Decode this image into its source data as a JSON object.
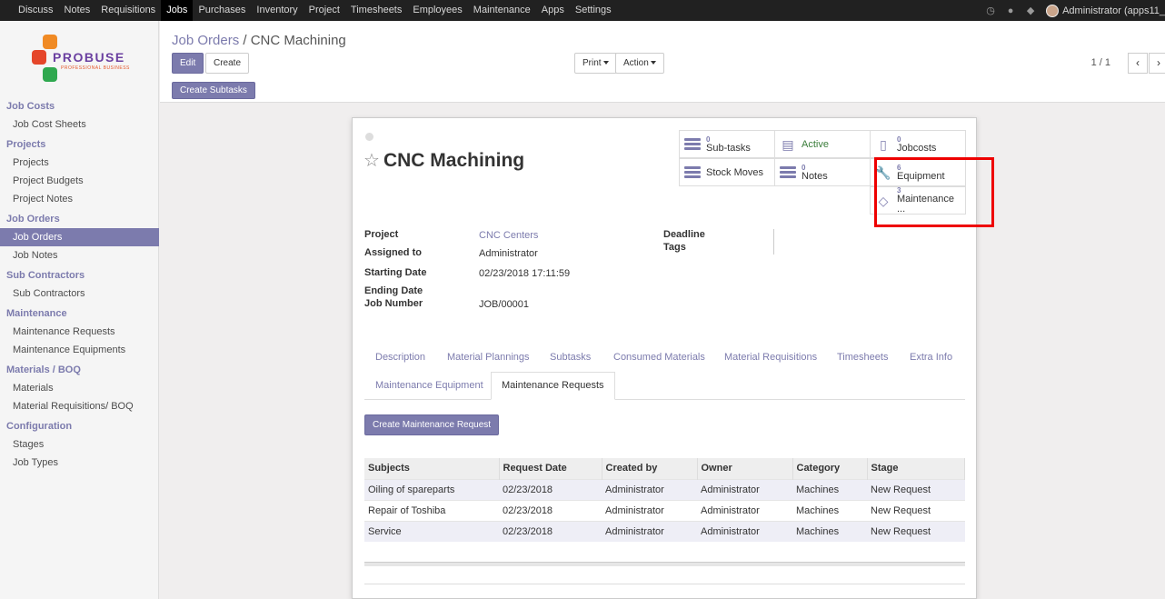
{
  "topnav": {
    "items": [
      "Discuss",
      "Notes",
      "Requisitions",
      "Jobs",
      "Purchases",
      "Inventory",
      "Project",
      "Timesheets",
      "Employees",
      "Maintenance",
      "Apps",
      "Settings"
    ],
    "active": "Jobs",
    "user": "Administrator (apps11_"
  },
  "logo": {
    "word": "PROBUSE",
    "tagline": "PROFESSIONAL BUSINESS"
  },
  "sidebar": {
    "sections": [
      {
        "title": "Job Costs",
        "items": [
          "Job Cost Sheets"
        ]
      },
      {
        "title": "Projects",
        "items": [
          "Projects",
          "Project Budgets",
          "Project Notes"
        ]
      },
      {
        "title": "Job Orders",
        "items": [
          "Job Orders",
          "Job Notes"
        ]
      },
      {
        "title": "Sub Contractors",
        "items": [
          "Sub Contractors"
        ]
      },
      {
        "title": "Maintenance",
        "items": [
          "Maintenance Requests",
          "Maintenance Equipments"
        ]
      },
      {
        "title": "Materials / BOQ",
        "items": [
          "Materials",
          "Material Requisitions/ BOQ"
        ]
      },
      {
        "title": "Configuration",
        "items": [
          "Stages",
          "Job Types"
        ]
      }
    ],
    "active_item": "Job Orders"
  },
  "control_panel": {
    "breadcrumb_parent": "Job Orders",
    "breadcrumb_sep": "/",
    "breadcrumb_current": "CNC Machining",
    "edit_label": "Edit",
    "create_label": "Create",
    "print_label": "Print",
    "action_label": "Action",
    "pager": "1 / 1",
    "create_subtasks_label": "Create Subtasks"
  },
  "form": {
    "title": "CNC Machining",
    "smart_buttons": {
      "subtasks": {
        "count": "0",
        "label": "Sub-tasks"
      },
      "active": {
        "label": "Active"
      },
      "jobcosts": {
        "count": "0",
        "label": "Jobcosts"
      },
      "stock_moves": {
        "label": "Stock Moves"
      },
      "notes": {
        "count": "0",
        "label": "Notes"
      },
      "equipment": {
        "count": "6",
        "label": "Equipment"
      },
      "maintenance": {
        "count": "3",
        "label": "Maintenance ..."
      }
    },
    "fields": {
      "project_label": "Project",
      "project_value": "CNC Centers",
      "assigned_label": "Assigned to",
      "assigned_value": "Administrator",
      "start_label": "Starting Date",
      "start_value": "02/23/2018 17:11:59",
      "end_label": "Ending Date",
      "jobnum_label": "Job Number",
      "jobnum_value": "JOB/00001",
      "deadline_label": "Deadline",
      "tags_label": "Tags"
    },
    "tabs": [
      "Description",
      "Material Plannings",
      "Subtasks",
      "Consumed Materials",
      "Material Requisitions",
      "Timesheets",
      "Extra Info",
      "Maintenance Equipment",
      "Maintenance Requests"
    ],
    "active_tab": "Maintenance Requests",
    "create_request_label": "Create Maintenance Request",
    "table": {
      "columns": [
        "Subjects",
        "Request Date",
        "Created by",
        "Owner",
        "Category",
        "Stage"
      ],
      "rows": [
        [
          "Oiling of spareparts",
          "02/23/2018",
          "Administrator",
          "Administrator",
          "Machines",
          "New Request"
        ],
        [
          "Repair of Toshiba",
          "02/23/2018",
          "Administrator",
          "Administrator",
          "Machines",
          "New Request"
        ],
        [
          "Service",
          "02/23/2018",
          "Administrator",
          "Administrator",
          "Machines",
          "New Request"
        ]
      ]
    }
  },
  "colors": {
    "accent": "#7c7bad",
    "topbar": "#212121",
    "highlight_box": "#e00000"
  }
}
